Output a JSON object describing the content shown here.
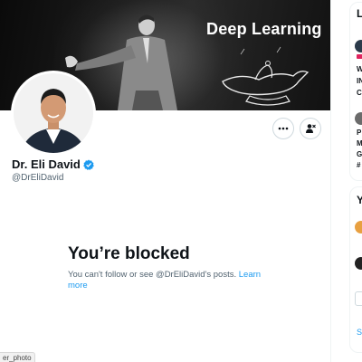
{
  "profile": {
    "banner_text": "Deep Learning",
    "display_name": "Dr. Eli David",
    "handle": "@DrEliDavid",
    "verified": true
  },
  "blocked": {
    "title": "You’re blocked",
    "message_prefix": "You can't follow or see @DrEliDavid's posts.",
    "learn_more": "Learn more"
  },
  "status_chip": "er_photo",
  "sidebar": {
    "card1_title": "L",
    "card1_lines": [
      "W",
      "IN",
      "C",
      "P",
      "M",
      "G",
      "#"
    ],
    "card2_title": "Y",
    "show_more": "S"
  },
  "colors": {
    "accent": "#1d9bf0",
    "text_primary": "#0f1419",
    "text_secondary": "#536471"
  },
  "icons": [
    "more-icon",
    "block-user-icon",
    "verified-badge-icon"
  ]
}
